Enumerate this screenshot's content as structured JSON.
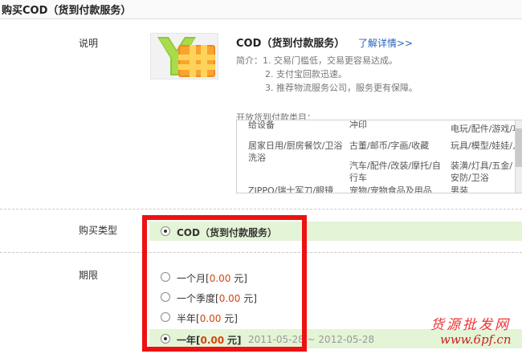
{
  "page": {
    "title": "购买COD（货到付款服务）"
  },
  "description": {
    "label": "说明",
    "product_title": "COD（货到付款服务）",
    "details_link": "了解详情>>",
    "intro": [
      "简介：1. 交易门槛低，交易更容易达成。",
      "2. 支付宝回款迅速。",
      "3. 推荐物流服务公司，服务更有保障。"
    ],
    "categories_label": "开放货到付款类目：",
    "categories": [
      "给设备",
      "冲印",
      "电玩/配件/游戏/攻",
      "居家日用/厨房餐饮/卫浴洗浴",
      "古董/邮币/字画/收藏",
      "玩具/模型/娃娃/人",
      "汽车/配件/改装/摩托/自行车",
      "装潢/灯具/五金/安防/卫浴",
      "ZIPPO/瑞士军刀/眼镜",
      "宠物/宠物食品及用品",
      "男装"
    ]
  },
  "purchase_type": {
    "label": "购买类型",
    "option": "COD（货到付款服务）"
  },
  "period": {
    "label": "期限",
    "options": [
      {
        "name": "一个月",
        "price": "0.00",
        "unit": "元"
      },
      {
        "name": "一个季度",
        "price": "0.00",
        "unit": "元"
      },
      {
        "name": "半年",
        "price": "0.00",
        "unit": "元"
      },
      {
        "name": "一年",
        "price": "0.00",
        "unit": "元"
      }
    ],
    "selected_range": "2011-05-28 ~ 2012-05-28"
  },
  "watermark": {
    "text": "货源批发网",
    "url": "www.6pf.cn"
  },
  "colors": {
    "accent_band": "#e4f4d6",
    "price": "#d2460f",
    "highlight_frame": "#ee1111",
    "link": "#2a62b8"
  }
}
